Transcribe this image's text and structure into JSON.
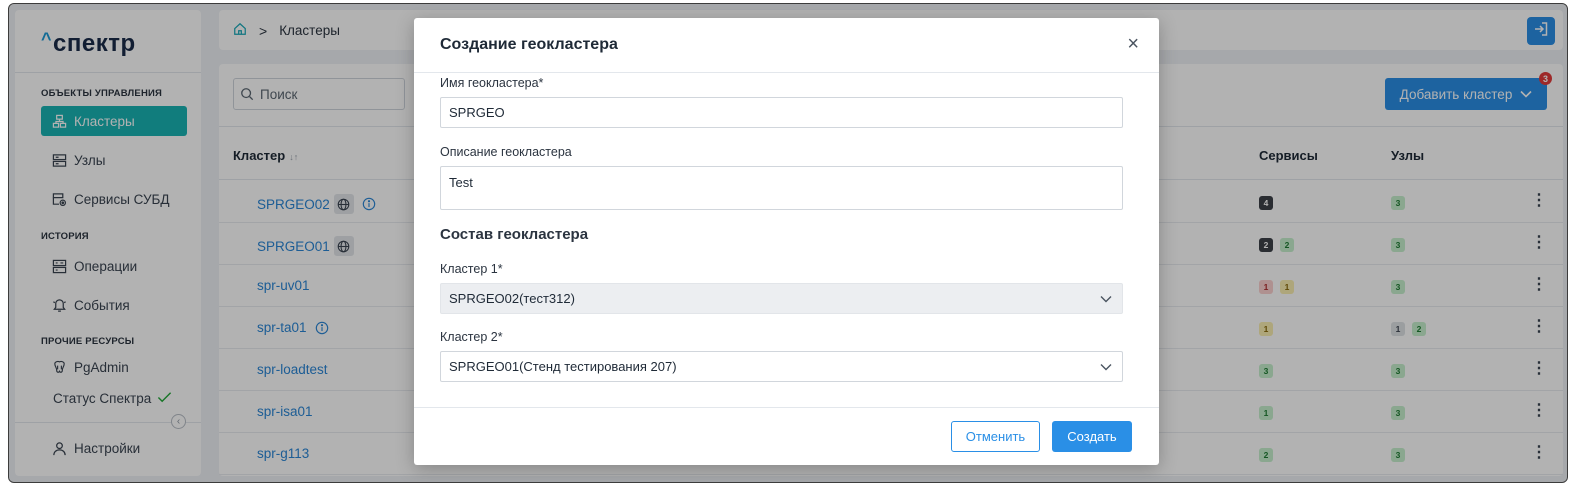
{
  "app": {
    "logo_caret": "^",
    "logo_text": "спектр"
  },
  "sidebar": {
    "section_objects": "ОБЪЕКТЫ УПРАВЛЕНИЯ",
    "section_history": "ИСТОРИЯ",
    "section_other": "ПРОЧИЕ РЕСУРСЫ",
    "items": [
      {
        "label": "Кластеры",
        "icon": "cluster-icon"
      },
      {
        "label": "Узлы",
        "icon": "server-icon"
      },
      {
        "label": "Сервисы СУБД",
        "icon": "database-settings-icon"
      },
      {
        "label": "Операции",
        "icon": "operations-icon"
      },
      {
        "label": "События",
        "icon": "events-icon"
      },
      {
        "label": "PgAdmin",
        "icon": "pgadmin-icon"
      },
      {
        "label": "Статус Спектра",
        "icon": "check-icon"
      },
      {
        "label": "Настройки",
        "icon": "user-icon"
      }
    ],
    "collapse_glyph": "‹"
  },
  "breadcrumb": {
    "separator": ">",
    "current": "Кластеры"
  },
  "toolbar": {
    "search_placeholder": "Поиск",
    "add_label": "Добавить кластер",
    "notification_count": "3"
  },
  "table": {
    "columns": {
      "cluster": "Кластер",
      "sort_glyph": "↓↑",
      "services": "Сервисы",
      "nodes": "Узлы"
    },
    "rows": [
      {
        "name": "SPRGEO02",
        "globe": true,
        "info": true,
        "services": [
          {
            "v": "4",
            "c": "dark"
          }
        ],
        "nodes": [
          {
            "v": "3",
            "c": "green"
          }
        ]
      },
      {
        "name": "SPRGEO01",
        "globe": true,
        "info": false,
        "services": [
          {
            "v": "2",
            "c": "dark"
          },
          {
            "v": "2",
            "c": "green"
          }
        ],
        "nodes": [
          {
            "v": "3",
            "c": "green"
          }
        ]
      },
      {
        "name": "spr-uv01",
        "globe": false,
        "info": false,
        "services": [
          {
            "v": "1",
            "c": "red"
          },
          {
            "v": "1",
            "c": "yellow"
          }
        ],
        "nodes": [
          {
            "v": "3",
            "c": "green"
          }
        ]
      },
      {
        "name": "spr-ta01",
        "globe": false,
        "info": true,
        "services": [
          {
            "v": "1",
            "c": "yellow"
          }
        ],
        "nodes": [
          {
            "v": "1",
            "c": "grey"
          },
          {
            "v": "2",
            "c": "green"
          }
        ]
      },
      {
        "name": "spr-loadtest",
        "globe": false,
        "info": false,
        "services": [
          {
            "v": "3",
            "c": "green"
          }
        ],
        "nodes": [
          {
            "v": "3",
            "c": "green"
          }
        ]
      },
      {
        "name": "spr-isa01",
        "globe": false,
        "info": false,
        "services": [
          {
            "v": "1",
            "c": "green"
          }
        ],
        "nodes": [
          {
            "v": "3",
            "c": "green"
          }
        ]
      },
      {
        "name": "spr-g113",
        "globe": false,
        "info": false,
        "services": [
          {
            "v": "2",
            "c": "green"
          }
        ],
        "nodes": [
          {
            "v": "3",
            "c": "green"
          }
        ]
      }
    ],
    "kebab_glyph": "⋮"
  },
  "modal": {
    "title": "Создание геокластера",
    "close_glyph": "×",
    "name_label": "Имя геокластера*",
    "name_value": "SPRGEO",
    "description_label": "Описание геокластера",
    "description_value": "Test",
    "composition_title": "Состав геокластера",
    "cluster1_label": "Кластер 1*",
    "cluster1_value": "SPRGEO02(тест312)",
    "cluster2_label": "Кластер 2*",
    "cluster2_value": "SPRGEO01(Стенд тестирования 207)",
    "cancel_label": "Отменить",
    "create_label": "Создать"
  },
  "colors": {
    "accent": "#2a8fe6",
    "active_nav": "#19b3b3",
    "link": "#2a86d6",
    "notification": "#e23c3c"
  }
}
